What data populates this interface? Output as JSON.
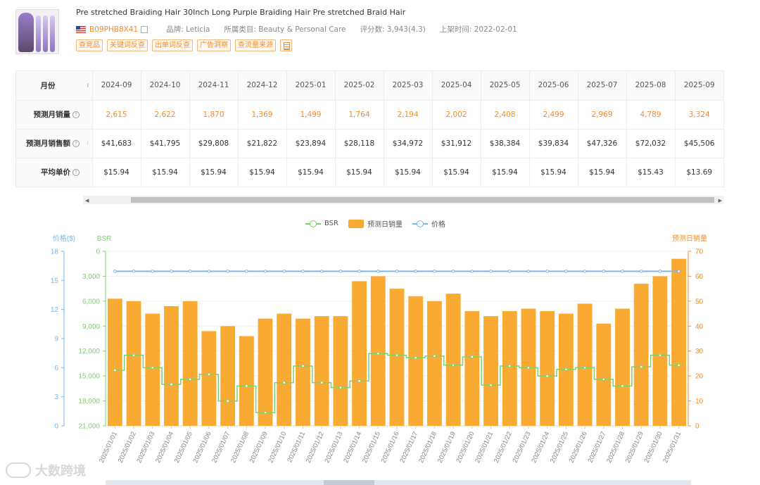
{
  "product": {
    "title": "Pre stretched Braiding Hair 30Inch Long Purple Braiding Hair Pre stretched Braid Hair",
    "asin": "B09PHB8X41",
    "brand": "品牌: Leticia",
    "category": "所属类目: Beauty & Personal Care",
    "rating": "评分数: 3,943(4.3)",
    "listed": "上架时间: 2022-02-01",
    "tags": [
      "查竞品",
      "关键词反查",
      "出单词反查",
      "广告洞察",
      "查流量来源"
    ]
  },
  "table": {
    "header_label": "月份",
    "months": [
      "2024-09",
      "2024-10",
      "2024-11",
      "2024-12",
      "2025-01",
      "2025-02",
      "2025-03",
      "2025-04",
      "2025-05",
      "2025-06",
      "2025-07",
      "2025-08",
      "2025-09"
    ],
    "rows": [
      {
        "label": "预测月销量",
        "values": [
          "2,615",
          "2,622",
          "1,870",
          "1,369",
          "1,499",
          "1,764",
          "2,194",
          "2,002",
          "2,408",
          "2,499",
          "2,969",
          "4,789",
          "3,324"
        ]
      },
      {
        "label": "预测月销售额",
        "values": [
          "$41,683",
          "$41,795",
          "$29,808",
          "$21,822",
          "$23,894",
          "$28,118",
          "$34,972",
          "$31,912",
          "$38,384",
          "$39,834",
          "$47,326",
          "$72,032",
          "$45,506"
        ]
      },
      {
        "label": "平均单价",
        "values": [
          "$15.94",
          "$15.94",
          "$15.94",
          "$15.94",
          "$15.94",
          "$15.94",
          "$15.94",
          "$15.94",
          "$15.94",
          "$15.94",
          "$15.94",
          "$15.43",
          "$13.69"
        ]
      }
    ]
  },
  "legend": {
    "bsr": "BSR",
    "sales": "预测日销量",
    "price": "价格"
  },
  "watermark": "大数跨境",
  "colors": {
    "accent": "#f08c2e",
    "bar": "#f9aa33",
    "bsr": "#7fcf6d",
    "price": "#7bb6e8"
  },
  "chart_data": {
    "type": "bar",
    "x": [
      "2025/01/01",
      "2025/01/02",
      "2025/01/03",
      "2025/01/04",
      "2025/01/05",
      "2025/01/06",
      "2025/01/07",
      "2025/01/08",
      "2025/01/09",
      "2025/01/10",
      "2025/01/11",
      "2025/01/12",
      "2025/01/13",
      "2025/01/14",
      "2025/01/15",
      "2025/01/16",
      "2025/01/17",
      "2025/01/18",
      "2025/01/19",
      "2025/01/20",
      "2025/01/21",
      "2025/01/22",
      "2025/01/23",
      "2025/01/24",
      "2025/01/25",
      "2025/01/26",
      "2025/01/27",
      "2025/01/28",
      "2025/01/29",
      "2025/01/30",
      "2025/01/31"
    ],
    "series": [
      {
        "name": "预测日销量",
        "type": "bar",
        "axis": "right",
        "values": [
          51,
          50,
          45,
          48,
          50,
          38,
          40,
          36,
          43,
          45,
          43,
          44,
          44,
          58,
          60,
          55,
          52,
          50,
          53,
          46,
          44,
          46,
          47,
          46,
          45,
          49,
          41,
          47,
          57,
          60,
          67
        ]
      },
      {
        "name": "BSR",
        "type": "line",
        "axis": "bsr",
        "values": [
          14300,
          12500,
          14000,
          16000,
          15400,
          14800,
          18000,
          16200,
          19400,
          15800,
          13800,
          15800,
          16400,
          15600,
          12300,
          12500,
          12800,
          12600,
          13700,
          12700,
          16100,
          13800,
          14000,
          15000,
          14200,
          14000,
          15400,
          16200,
          13900,
          12500,
          13700
        ]
      },
      {
        "name": "价格",
        "type": "line",
        "axis": "price",
        "values": [
          15.94,
          15.94,
          15.94,
          15.94,
          15.94,
          15.94,
          15.94,
          15.94,
          15.94,
          15.94,
          15.94,
          15.94,
          15.94,
          15.94,
          15.94,
          15.94,
          15.94,
          15.94,
          15.94,
          15.94,
          15.94,
          15.94,
          15.94,
          15.94,
          15.94,
          15.94,
          15.94,
          15.94,
          15.94,
          15.94,
          15.94
        ]
      }
    ],
    "axes": {
      "price": {
        "label": "价格($)",
        "ticks": [
          "18",
          "15",
          "12",
          "9",
          "6",
          "3",
          "0"
        ],
        "range": [
          0,
          18
        ]
      },
      "bsr": {
        "label": "BSR",
        "ticks": [
          "0",
          "3,000",
          "6,000",
          "9,000",
          "12,000",
          "15,000",
          "18,000",
          "21,000"
        ],
        "range": [
          0,
          21000
        ],
        "inverted": true
      },
      "sales": {
        "label": "预测日销量",
        "ticks": [
          "70",
          "60",
          "50",
          "40",
          "30",
          "20",
          "10",
          "0"
        ],
        "range": [
          0,
          70
        ]
      }
    },
    "grid": true,
    "legend_position": "top-center"
  }
}
